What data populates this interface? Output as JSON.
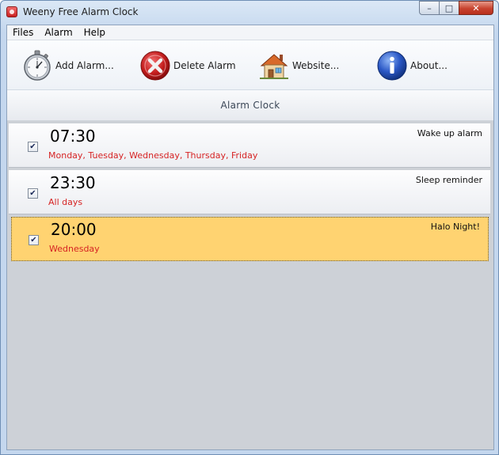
{
  "window": {
    "title": "Weeny Free Alarm Clock",
    "controls": {
      "minimize": "–",
      "maximize": "□",
      "close": "✕"
    }
  },
  "menu": [
    "Files",
    "Alarm",
    "Help"
  ],
  "toolbar": {
    "add_label": "Add Alarm...",
    "delete_label": "Delete Alarm",
    "website_label": "Website...",
    "about_label": "About...",
    "icons": [
      "stopwatch-icon",
      "delete-x-icon",
      "house-icon",
      "info-icon"
    ]
  },
  "header": {
    "title": "Alarm  Clock"
  },
  "alarms": [
    {
      "time": "07:30",
      "days": "Monday, Tuesday, Wednesday, Thursday, Friday",
      "label": "Wake up alarm",
      "checked": "✔",
      "selected": false
    },
    {
      "time": "23:30",
      "days": "All days",
      "label": "Sleep reminder",
      "checked": "✔",
      "selected": false
    },
    {
      "time": "20:00",
      "days": "Wednesday",
      "label": "Halo Night!",
      "checked": "✔",
      "selected": true
    }
  ],
  "colors": {
    "days_text": "#d62323",
    "selected_row": "#ffd371",
    "list_background": "#cdd1d7"
  }
}
